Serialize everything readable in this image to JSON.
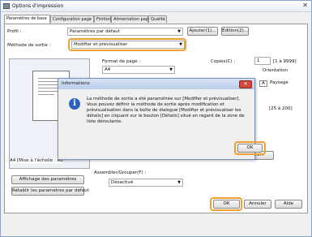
{
  "window": {
    "title": "Options d'impression",
    "close_glyph": "✕"
  },
  "tabs": [
    "Paramètres de base",
    "Configuration page",
    "Finition",
    "Alimentation papier",
    "Qualité"
  ],
  "profile": {
    "label": "Profil :",
    "value": "Paramètres par défaut",
    "add_label": "Ajouter(1)...",
    "edit_label": "Edition(2)..."
  },
  "output": {
    "label": "Méthode de sortie :",
    "value": "Modifier et prévisualiser"
  },
  "page": {
    "format_label": "Format de page :",
    "format_value": "A4",
    "copies_label": "Copies(C) :",
    "copies_value": "1",
    "copies_range": "[1 à 9999]",
    "orientation_label": "Orientation",
    "orientation_letter": "A",
    "orientation_value": "Paysage",
    "range_hint": "[25 à 200]"
  },
  "preview": {
    "caption": "A4 [Mise à l'échelle : Au"
  },
  "buttons": {
    "show_settings": "Affichage des paramètres",
    "restore_defaults": "Rétablir les paramètres par défaut",
    "ok": "OK",
    "cancel": "Annuler",
    "help": "Aide",
    "details_partial": "ière..."
  },
  "collate": {
    "label": "Assembler/Grouper(F) :",
    "value": "Désactivé"
  },
  "dialog": {
    "title": "Informations",
    "icon": "i",
    "message": "La méthode de sortie a été paramétrée sur [Modifier et prévisualiser]. Vous pouvez définir la méthode de sortie après modification et prévisualisation dans la boîte de dialogue [Modifier et prévisualiser les détails] en cliquant sur le bouton [Détails] situé en regard de la zone de liste déroulante.",
    "ok_label": "OK",
    "close_glyph": "✕"
  },
  "highlight_color": "#f0a030"
}
